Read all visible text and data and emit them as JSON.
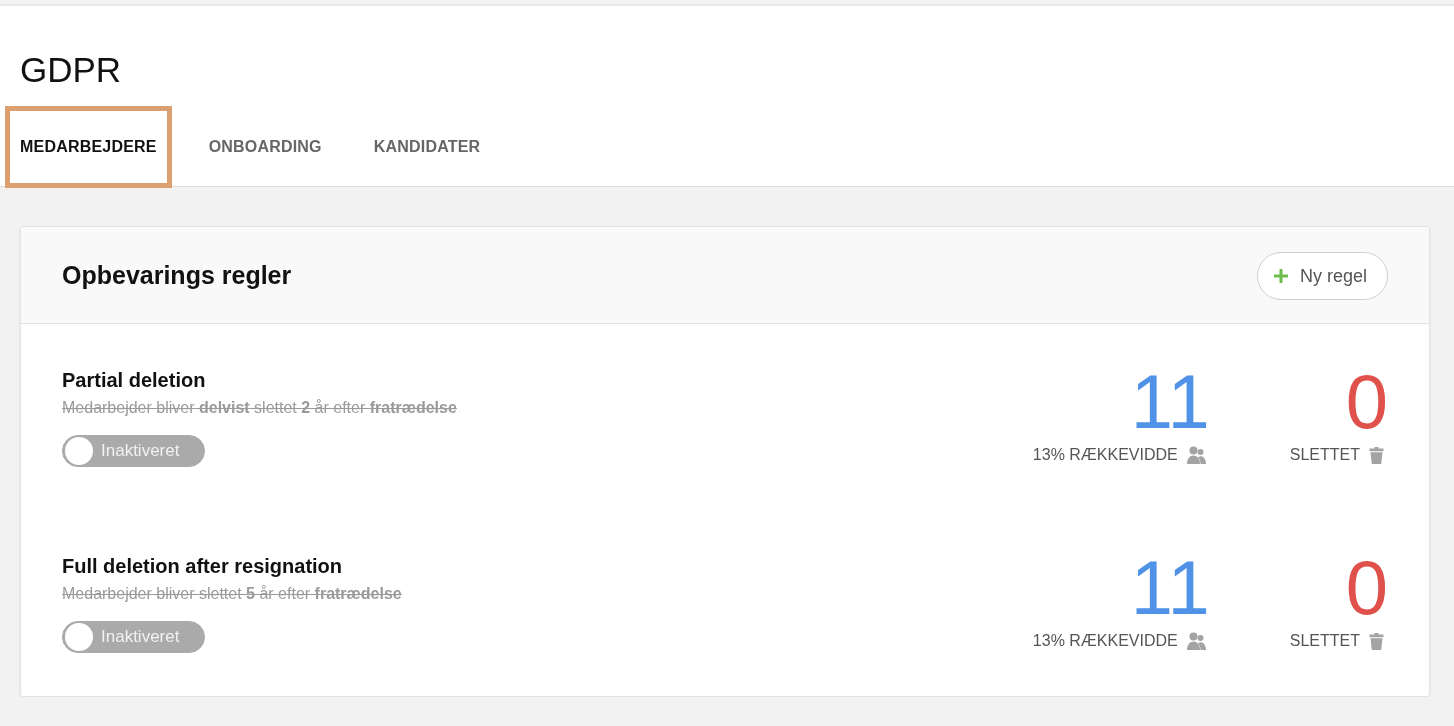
{
  "page": {
    "title": "GDPR"
  },
  "tabs": [
    {
      "label": "MEDARBEJDERE",
      "selected": true
    },
    {
      "label": "ONBOARDING",
      "selected": false
    },
    {
      "label": "KANDIDATER",
      "selected": false
    }
  ],
  "retention_card": {
    "title": "Opbevarings regler",
    "new_button": "Ny regel",
    "rules": [
      {
        "title": "Partial deletion",
        "description": "Medarbejder bliver **delvist** slettet **2** år efter **fratrædelse**",
        "active": false,
        "toggle_label": "Inaktiveret",
        "reach_count": "11",
        "reach_label": "13% RÆKKEVIDDE",
        "deleted_count": "0",
        "deleted_label": "SLETTET"
      },
      {
        "title": "Full deletion after resignation",
        "description": "Medarbejder bliver slettet **5** år efter **fratrædelse**",
        "active": false,
        "toggle_label": "Inaktiveret",
        "reach_count": "11",
        "reach_label": "13% RÆKKEVIDDE",
        "deleted_count": "0",
        "deleted_label": "SLETTET"
      }
    ]
  }
}
